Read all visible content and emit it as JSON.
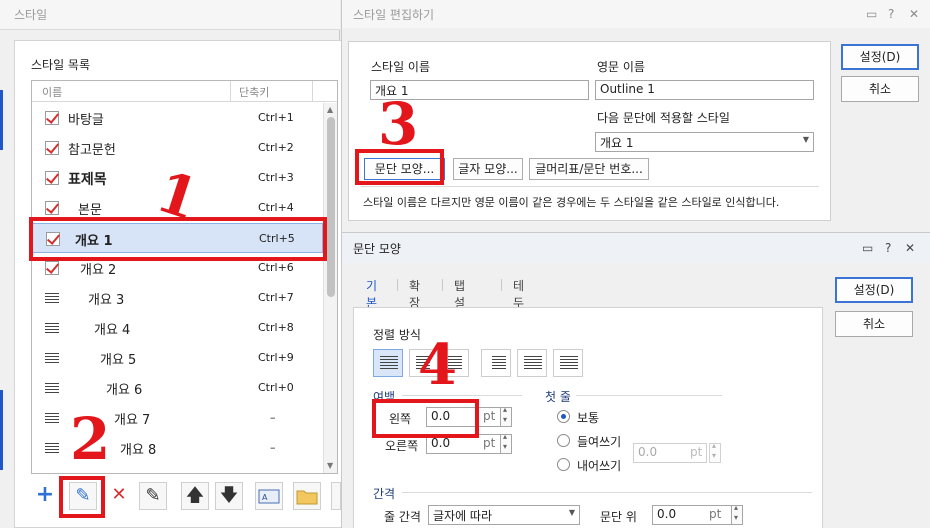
{
  "style_list_window": {
    "title": "스타일",
    "section_label": "스타일 목록",
    "columns": {
      "name": "이름",
      "shortcut": "단축키"
    },
    "items": [
      {
        "name": "바탕글",
        "shortcut": "Ctrl+1",
        "icon": "checked-style-icon"
      },
      {
        "name": "참고문헌",
        "shortcut": "Ctrl+2",
        "icon": "checked-style-icon"
      },
      {
        "name": "표제목",
        "shortcut": "Ctrl+3",
        "icon": "checked-style-icon"
      },
      {
        "name": "본문",
        "shortcut": "Ctrl+4",
        "icon": "checked-style-icon"
      },
      {
        "name": "개요 1",
        "shortcut": "Ctrl+5",
        "icon": "checked-style-icon",
        "selected": true
      },
      {
        "name": "개요 2",
        "shortcut": "Ctrl+6",
        "icon": "checked-style-icon"
      },
      {
        "name": "개요 3",
        "shortcut": "Ctrl+7",
        "icon": "paragraph-style-icon"
      },
      {
        "name": "개요 4",
        "shortcut": "Ctrl+8",
        "icon": "paragraph-style-icon"
      },
      {
        "name": "개요 5",
        "shortcut": "Ctrl+9",
        "icon": "paragraph-style-icon"
      },
      {
        "name": "개요 6",
        "shortcut": "Ctrl+0",
        "icon": "paragraph-style-icon"
      },
      {
        "name": "개요 7",
        "shortcut": "–",
        "icon": "paragraph-style-icon"
      },
      {
        "name": "개요 8",
        "shortcut": "–",
        "icon": "paragraph-style-icon"
      }
    ],
    "toolbar": {
      "add": "+",
      "edit": "✎",
      "delete": "✕",
      "edit_alt": "✎",
      "up": "🡅",
      "down": "🡇"
    }
  },
  "style_edit_window": {
    "title": "스타일 편집하기",
    "style_name_label": "스타일 이름",
    "style_name_value": "개요 1",
    "english_name_label": "영문 이름",
    "english_name_value": "Outline 1",
    "next_style_label": "다음 문단에 적용할 스타일",
    "next_style_value": "개요 1",
    "btn_paragraph_shape": "문단 모양...",
    "btn_char_shape": "글자 모양...",
    "btn_bullet": "글머리표/문단 번호...",
    "note": "스타일 이름은 다르지만 영문 이름이 같은 경우에는 두 스타일을 같은 스타일로 인식합니다.",
    "btn_ok": "설정(D)",
    "btn_cancel": "취소"
  },
  "paragraph_window": {
    "title": "문단 모양",
    "tabs": [
      "기본",
      "확장",
      "탭 설정",
      "테두리/배경"
    ],
    "align_label": "정렬 방식",
    "margin_label": "여백",
    "left_label": "왼쪽",
    "left_value": "0.0",
    "right_label": "오른쪽",
    "right_value": "0.0",
    "unit": "pt",
    "first_line_label": "첫 줄",
    "radio_normal": "보통",
    "radio_indent": "들여쓰기",
    "radio_outdent": "내어쓰기",
    "indent_value": "0.0",
    "spacing_label": "간격",
    "line_spacing_label": "줄 간격",
    "line_spacing_value": "글자에 따라",
    "para_above_label": "문단 위",
    "para_above_value": "0.0",
    "btn_ok": "설정(D)",
    "btn_cancel": "취소"
  },
  "annotations": {
    "step1": "1",
    "step2": "2",
    "step3": "3",
    "step4": "4"
  },
  "colors": {
    "annotation_red": "#e3161b",
    "accent_blue": "#1f57c9",
    "selection": "#d7e3f6"
  }
}
